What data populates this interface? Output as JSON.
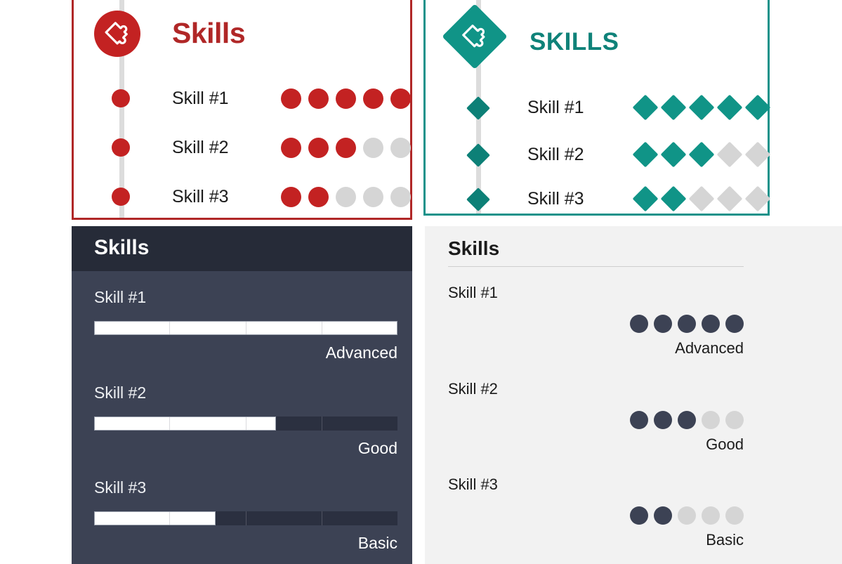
{
  "palette": {
    "red": "#c32222",
    "red_dark": "#b02727",
    "teal": "#109487",
    "teal_dark": "#0f8279",
    "empty_gray": "#d5d5d5",
    "dark_navy": "#3c4254",
    "dark_navy_header": "#262b38",
    "light_gray_bg": "#f2f2f2",
    "white": "#ffffff",
    "spine_gray": "#dcdcdc"
  },
  "panels": {
    "timeline_red": {
      "title": "Skills",
      "badge_icon": "puzzle-piece-icon",
      "marker_shape": "circle",
      "accent": "#c32222",
      "rows": [
        {
          "label": "Skill #1",
          "filled": 5,
          "total": 5
        },
        {
          "label": "Skill #2",
          "filled": 3,
          "total": 5
        },
        {
          "label": "Skill #3",
          "filled": 2,
          "total": 5
        }
      ]
    },
    "timeline_teal": {
      "title": "SKILLS",
      "badge_icon": "puzzle-piece-icon",
      "marker_shape": "diamond",
      "accent": "#109487",
      "rows": [
        {
          "label": "Skill #1",
          "filled": 5,
          "total": 5
        },
        {
          "label": "Skill #2",
          "filled": 3,
          "total": 5
        },
        {
          "label": "Skill #3",
          "filled": 2,
          "total": 5
        }
      ]
    },
    "bars_dark": {
      "title": "Skills",
      "segments": 4,
      "rows": [
        {
          "label": "Skill #1",
          "percent": 100,
          "level": "Advanced"
        },
        {
          "label": "Skill #2",
          "percent": 60,
          "level": "Good"
        },
        {
          "label": "Skill #3",
          "percent": 40,
          "level": "Basic"
        }
      ]
    },
    "dots_light": {
      "title": "Skills",
      "rows": [
        {
          "label": "Skill #1",
          "filled": 5,
          "total": 5,
          "level": "Advanced"
        },
        {
          "label": "Skill #2",
          "filled": 3,
          "total": 5,
          "level": "Good"
        },
        {
          "label": "Skill #3",
          "filled": 2,
          "total": 5,
          "level": "Basic"
        }
      ]
    }
  }
}
